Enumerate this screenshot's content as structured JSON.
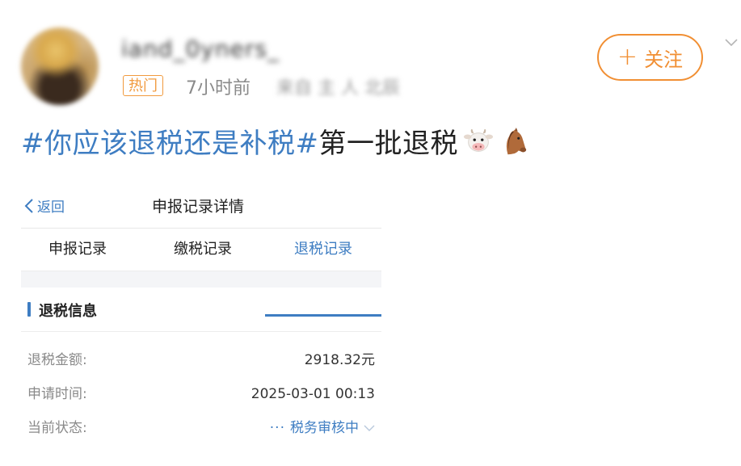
{
  "post": {
    "username": "iand_0yners_",
    "hot_badge": "热门",
    "time": "7小时前",
    "source": "来自 主 人 北辰",
    "follow_label": "关注",
    "text": {
      "hashtag": "#你应该退税还是补税#",
      "body": "第一批退税"
    },
    "emojis": [
      "cow-face-icon",
      "horse-face-icon"
    ]
  },
  "screenshot": {
    "nav": {
      "back_label": "返回",
      "title": "申报记录详情"
    },
    "tabs": [
      {
        "label": "申报记录",
        "active": false
      },
      {
        "label": "缴税记录",
        "active": false
      },
      {
        "label": "退税记录",
        "active": true
      }
    ],
    "section_title": "退税信息",
    "fields": [
      {
        "label": "退税金额:",
        "value": "2918.32元"
      },
      {
        "label": "申请时间:",
        "value": "2025-03-01 00:13"
      },
      {
        "label": "当前状态:",
        "value": "税务审核中",
        "prefix": "···"
      }
    ]
  },
  "colors": {
    "accent_blue": "#3e7dc2",
    "follow_orange": "#f18f33",
    "hot_orange": "#f19a3e"
  }
}
